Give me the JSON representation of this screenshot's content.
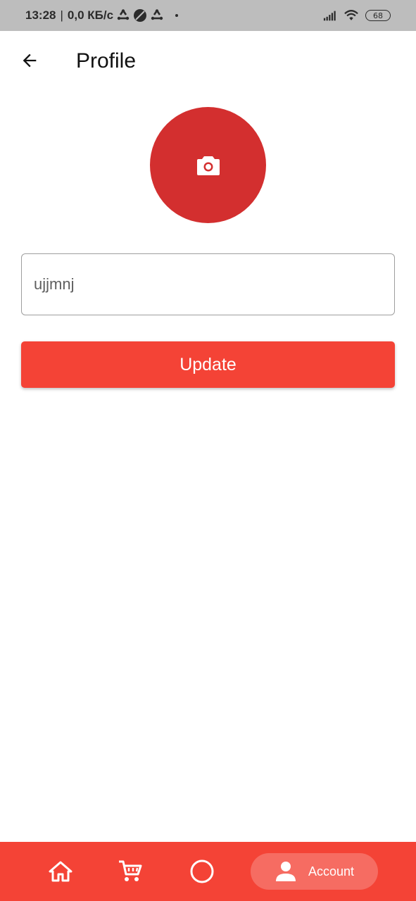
{
  "status_bar": {
    "time": "13:28",
    "separator": "|",
    "network_speed": "0,0 КБ/с",
    "battery_level": "68"
  },
  "app_bar": {
    "title": "Profile",
    "back_icon": "arrow-back-icon"
  },
  "avatar": {
    "icon": "camera-icon",
    "color": "#d32f2f"
  },
  "form": {
    "name_value": "ujjmnj",
    "update_label": "Update"
  },
  "bottom_nav": {
    "items": [
      {
        "icon": "home-icon"
      },
      {
        "icon": "cart-icon"
      },
      {
        "icon": "circle-icon"
      },
      {
        "icon": "person-icon",
        "label": "Account",
        "selected": true
      }
    ],
    "color": "#f44336"
  }
}
